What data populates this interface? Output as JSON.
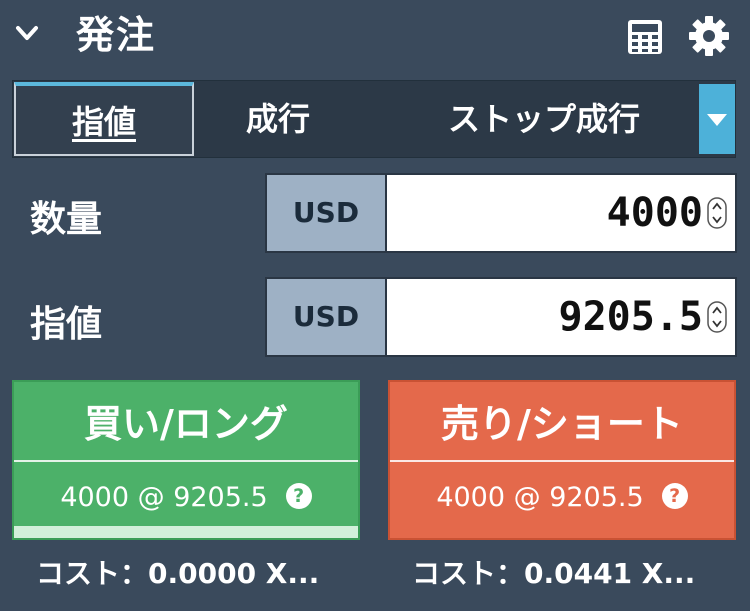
{
  "header": {
    "title": "発注",
    "collapse_icon": "chevron-down-icon",
    "calculator_icon": "calculator-icon",
    "settings_icon": "gear-icon"
  },
  "tabs": [
    {
      "label": "指値",
      "active": true
    },
    {
      "label": "成行",
      "active": false
    },
    {
      "label": "ストップ成行",
      "active": false
    }
  ],
  "tab_dropdown_icon": "caret-down-icon",
  "quantity": {
    "label": "数量",
    "currency": "USD",
    "value": "4000"
  },
  "limit_price": {
    "label": "指値",
    "currency": "USD",
    "value": "9205.5"
  },
  "buy": {
    "label": "買い/ロング",
    "summary": "4000 @ 9205.5",
    "help": "?",
    "cost": "コスト：0.0000 X...",
    "color": "#4cb169"
  },
  "sell": {
    "label": "売り/ショート",
    "summary": "4000 @ 9205.5",
    "help": "?",
    "cost": "コスト：0.0441 X...",
    "color": "#e4694b"
  },
  "colors": {
    "background": "#3a4a5c",
    "accent": "#4db1d9",
    "currency_box": "#9eb1c5"
  }
}
